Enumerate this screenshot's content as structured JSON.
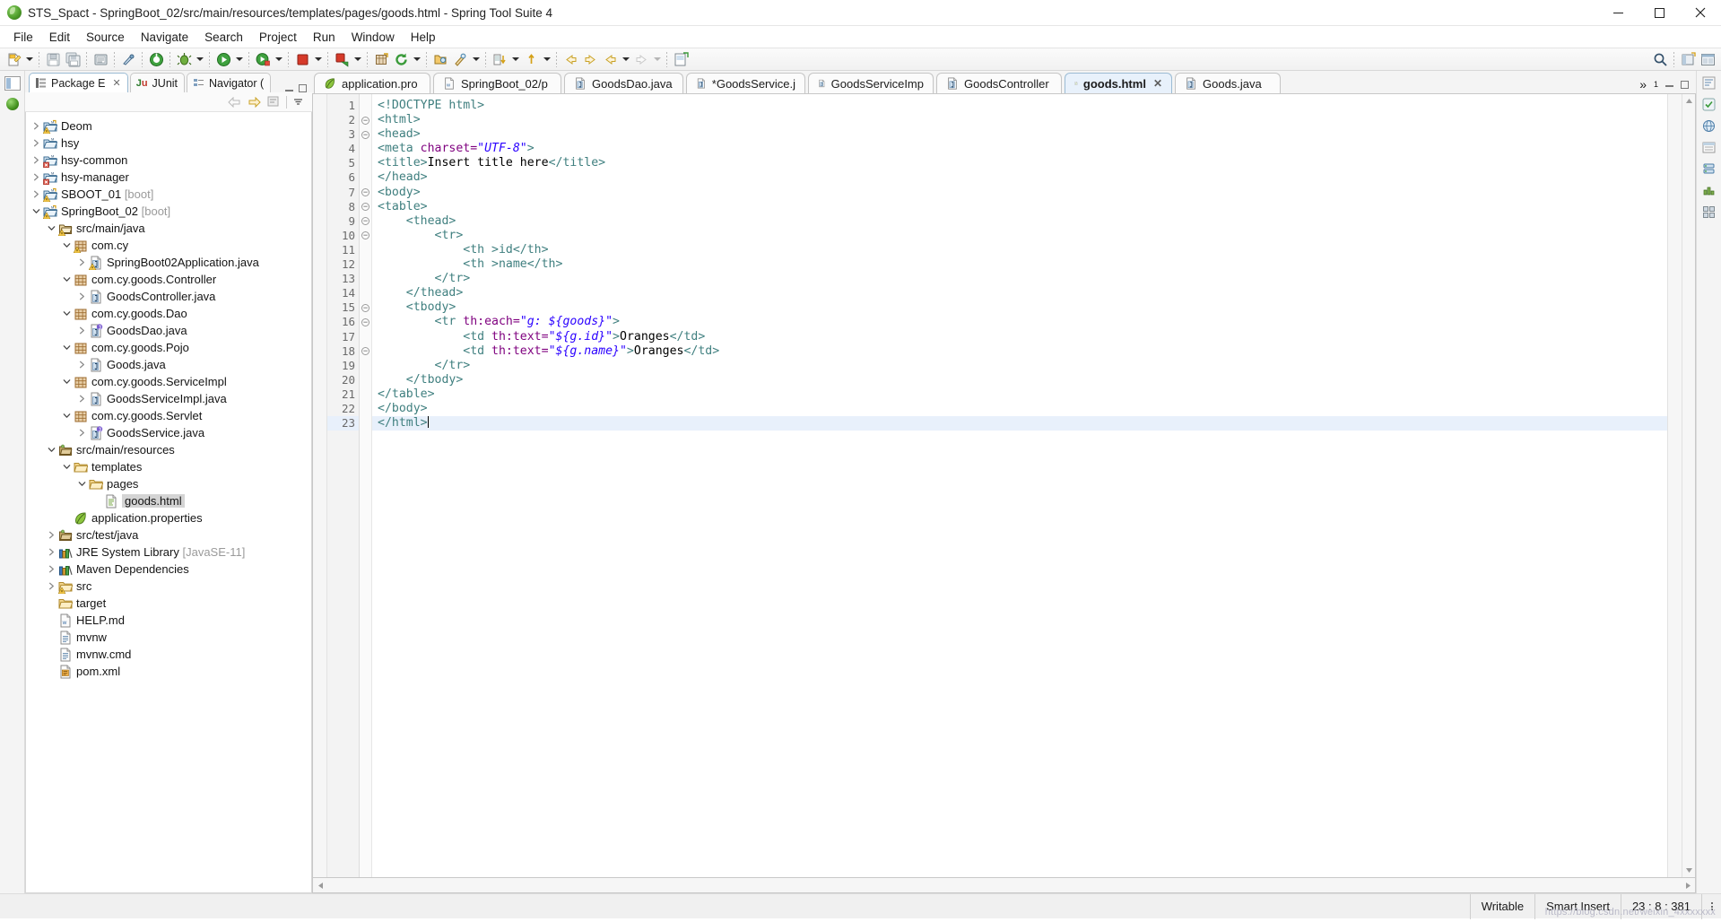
{
  "window": {
    "title": "STS_Spact - SpringBoot_02/src/main/resources/templates/pages/goods.html - Spring Tool Suite 4",
    "app_icon": "spring-leaf-icon",
    "controls": {
      "minimize": "minimize-button",
      "maximize": "maximize-button",
      "close": "close-button"
    }
  },
  "menubar": {
    "items": [
      "File",
      "Edit",
      "Source",
      "Navigate",
      "Search",
      "Project",
      "Run",
      "Window",
      "Help"
    ]
  },
  "toolbar": {
    "groups": [
      {
        "buttons": [
          {
            "icon": "new-wizard-icon",
            "dropdown": true
          }
        ]
      },
      {
        "buttons": [
          {
            "icon": "save-icon",
            "dropdown": false
          },
          {
            "icon": "save-all-icon",
            "dropdown": false
          }
        ]
      },
      {
        "buttons": [
          {
            "icon": "print-icon",
            "dropdown": false
          }
        ]
      },
      {
        "buttons": [
          {
            "icon": "quick-access-icon",
            "dropdown": false
          }
        ]
      },
      {
        "buttons": [
          {
            "icon": "boot-dashboard-icon",
            "dropdown": false
          }
        ]
      },
      {
        "buttons": [
          {
            "icon": "debug-icon",
            "dropdown": true
          }
        ]
      },
      {
        "buttons": [
          {
            "icon": "run-icon",
            "dropdown": true
          }
        ]
      },
      {
        "buttons": [
          {
            "icon": "run-coverage-icon",
            "dropdown": true
          }
        ]
      },
      {
        "buttons": [
          {
            "icon": "stop-icon",
            "dropdown": true
          }
        ]
      },
      {
        "buttons": [
          {
            "icon": "terminate-relaunch-icon",
            "dropdown": true
          }
        ]
      },
      {
        "buttons": [
          {
            "icon": "new-package-icon",
            "dropdown": false
          },
          {
            "icon": "refresh-icon",
            "dropdown": true
          }
        ]
      },
      {
        "buttons": [
          {
            "icon": "open-type-icon",
            "dropdown": false
          },
          {
            "icon": "search-icon",
            "dropdown": true
          }
        ]
      },
      {
        "buttons": [
          {
            "icon": "next-annotation-icon",
            "dropdown": true
          },
          {
            "icon": "previous-annotation-icon",
            "dropdown": true
          }
        ]
      },
      {
        "buttons": [
          {
            "icon": "back-icon",
            "dropdown": false
          },
          {
            "icon": "forward-icon",
            "dropdown": false
          },
          {
            "icon": "last-edit-icon",
            "dropdown": true
          },
          {
            "icon": "forward-nav-icon",
            "dropdown": true
          }
        ]
      },
      {
        "buttons": [
          {
            "icon": "new-editor-icon",
            "dropdown": false
          }
        ]
      }
    ],
    "right_buttons": [
      {
        "icon": "search-icon"
      },
      {
        "icon": "perspective-open-icon"
      },
      {
        "icon": "perspective-java-icon"
      }
    ]
  },
  "explorer": {
    "view_tabs": [
      {
        "label": "Package E",
        "icon": "package-explorer-icon",
        "active": true,
        "closable": true
      },
      {
        "label": "JUnit",
        "icon": "junit-icon",
        "active": false,
        "closable": false
      },
      {
        "label": "Navigator (",
        "icon": "navigator-icon",
        "active": false,
        "closable": false
      }
    ],
    "view_toolbar": [
      {
        "icon": "back-arrow-icon"
      },
      {
        "icon": "forward-arrow-icon"
      },
      {
        "icon": "collapse-all-icon"
      },
      {
        "icon": "link-with-editor-icon"
      },
      {
        "icon": "view-menu-icon"
      }
    ],
    "tree": [
      {
        "indent": 0,
        "twist": "collapsed",
        "icon": "java-project-warning-icon",
        "label": "Deom",
        "suffix": ""
      },
      {
        "indent": 0,
        "twist": "collapsed",
        "icon": "maven-project-icon",
        "label": "hsy",
        "suffix": ""
      },
      {
        "indent": 0,
        "twist": "collapsed",
        "icon": "maven-project-error-icon",
        "label": "hsy-common",
        "suffix": ""
      },
      {
        "indent": 0,
        "twist": "collapsed",
        "icon": "maven-project-error-icon",
        "label": "hsy-manager",
        "suffix": ""
      },
      {
        "indent": 0,
        "twist": "collapsed",
        "icon": "maven-java-project-warning-icon",
        "label": "SBOOT_01",
        "suffix": "[boot]"
      },
      {
        "indent": 0,
        "twist": "expanded",
        "icon": "maven-java-project-warning-icon",
        "label": "SpringBoot_02",
        "suffix": "[boot]"
      },
      {
        "indent": 1,
        "twist": "expanded",
        "icon": "source-folder-warning-icon",
        "label": "src/main/java",
        "suffix": ""
      },
      {
        "indent": 2,
        "twist": "expanded",
        "icon": "package-warning-icon",
        "label": "com.cy",
        "suffix": ""
      },
      {
        "indent": 3,
        "twist": "collapsed",
        "icon": "java-class-warning-icon",
        "label": "SpringBoot02Application.java",
        "suffix": ""
      },
      {
        "indent": 2,
        "twist": "expanded",
        "icon": "package-icon",
        "label": "com.cy.goods.Controller",
        "suffix": ""
      },
      {
        "indent": 3,
        "twist": "collapsed",
        "icon": "java-class-icon",
        "label": "GoodsController.java",
        "suffix": ""
      },
      {
        "indent": 2,
        "twist": "expanded",
        "icon": "package-icon",
        "label": "com.cy.goods.Dao",
        "suffix": ""
      },
      {
        "indent": 3,
        "twist": "collapsed",
        "icon": "java-interface-icon",
        "label": "GoodsDao.java",
        "suffix": ""
      },
      {
        "indent": 2,
        "twist": "expanded",
        "icon": "package-icon",
        "label": "com.cy.goods.Pojo",
        "suffix": ""
      },
      {
        "indent": 3,
        "twist": "collapsed",
        "icon": "java-class-icon",
        "label": "Goods.java",
        "suffix": ""
      },
      {
        "indent": 2,
        "twist": "expanded",
        "icon": "package-icon",
        "label": "com.cy.goods.ServiceImpl",
        "suffix": ""
      },
      {
        "indent": 3,
        "twist": "collapsed",
        "icon": "java-class-icon",
        "label": "GoodsServiceImpl.java",
        "suffix": ""
      },
      {
        "indent": 2,
        "twist": "expanded",
        "icon": "package-icon",
        "label": "com.cy.goods.Servlet",
        "suffix": ""
      },
      {
        "indent": 3,
        "twist": "collapsed",
        "icon": "java-interface-icon",
        "label": "GoodsService.java",
        "suffix": ""
      },
      {
        "indent": 1,
        "twist": "expanded",
        "icon": "source-folder-icon",
        "label": "src/main/resources",
        "suffix": ""
      },
      {
        "indent": 2,
        "twist": "expanded",
        "icon": "folder-icon",
        "label": "templates",
        "suffix": ""
      },
      {
        "indent": 3,
        "twist": "expanded",
        "icon": "folder-icon",
        "label": "pages",
        "suffix": ""
      },
      {
        "indent": 4,
        "twist": "none",
        "icon": "html-file-icon",
        "label": "goods.html",
        "suffix": "",
        "selected": true
      },
      {
        "indent": 2,
        "twist": "none",
        "icon": "properties-leaf-icon",
        "label": "application.properties",
        "suffix": ""
      },
      {
        "indent": 1,
        "twist": "collapsed",
        "icon": "source-folder-icon",
        "label": "src/test/java",
        "suffix": ""
      },
      {
        "indent": 1,
        "twist": "collapsed",
        "icon": "library-icon",
        "label": "JRE System Library",
        "suffix": "[JavaSE-11]"
      },
      {
        "indent": 1,
        "twist": "collapsed",
        "icon": "library-icon",
        "label": "Maven Dependencies",
        "suffix": ""
      },
      {
        "indent": 1,
        "twist": "collapsed",
        "icon": "folder-warning-icon",
        "label": "src",
        "suffix": ""
      },
      {
        "indent": 1,
        "twist": "none",
        "icon": "folder-icon",
        "label": "target",
        "suffix": ""
      },
      {
        "indent": 1,
        "twist": "none",
        "icon": "markdown-file-icon",
        "label": "HELP.md",
        "suffix": ""
      },
      {
        "indent": 1,
        "twist": "none",
        "icon": "text-file-icon",
        "label": "mvnw",
        "suffix": ""
      },
      {
        "indent": 1,
        "twist": "none",
        "icon": "text-file-icon",
        "label": "mvnw.cmd",
        "suffix": ""
      },
      {
        "indent": 1,
        "twist": "none",
        "icon": "xml-file-icon",
        "label": "pom.xml",
        "suffix": ""
      }
    ]
  },
  "editor": {
    "tabs": [
      {
        "label": "application.pro",
        "icon": "properties-leaf-icon",
        "active": false,
        "dirty": false,
        "closable": false
      },
      {
        "label": "SpringBoot_02/p",
        "icon": "markdown-file-icon",
        "active": false,
        "dirty": false,
        "closable": false
      },
      {
        "label": "GoodsDao.java",
        "icon": "java-file-icon",
        "active": false,
        "dirty": false,
        "closable": false
      },
      {
        "label": "*GoodsService.j",
        "icon": "java-file-icon",
        "active": false,
        "dirty": true,
        "closable": false
      },
      {
        "label": "GoodsServiceImp",
        "icon": "java-file-icon",
        "active": false,
        "dirty": false,
        "closable": false
      },
      {
        "label": "GoodsController",
        "icon": "java-file-icon",
        "active": false,
        "dirty": false,
        "closable": false
      },
      {
        "label": "goods.html",
        "icon": "html-file-icon",
        "active": true,
        "dirty": false,
        "closable": true
      },
      {
        "label": "Goods.java",
        "icon": "java-file-icon",
        "active": false,
        "dirty": false,
        "closable": false
      }
    ],
    "overflow_label": "»",
    "overflow_count": "1",
    "lines": [
      {
        "num": "1",
        "fold": "none",
        "indent": 0,
        "tokens": [
          {
            "t": "tag",
            "v": "<!DOCTYPE html>"
          }
        ]
      },
      {
        "num": "2",
        "fold": "collapse",
        "indent": 0,
        "tokens": [
          {
            "t": "tag",
            "v": "<html>"
          }
        ]
      },
      {
        "num": "3",
        "fold": "collapse",
        "indent": 0,
        "tokens": [
          {
            "t": "tag",
            "v": "<head>"
          }
        ]
      },
      {
        "num": "4",
        "fold": "none",
        "indent": 0,
        "tokens": [
          {
            "t": "tag",
            "v": "<meta "
          },
          {
            "t": "attr",
            "v": "charset="
          },
          {
            "t": "val",
            "v": "\"UTF-8\""
          },
          {
            "t": "tag",
            "v": ">"
          }
        ]
      },
      {
        "num": "5",
        "fold": "none",
        "indent": 0,
        "tokens": [
          {
            "t": "tag",
            "v": "<title>"
          },
          {
            "t": "txt",
            "v": "Insert title here"
          },
          {
            "t": "tag",
            "v": "</title>"
          }
        ]
      },
      {
        "num": "6",
        "fold": "none",
        "indent": 0,
        "tokens": [
          {
            "t": "tag",
            "v": "</head>"
          }
        ]
      },
      {
        "num": "7",
        "fold": "collapse",
        "indent": 0,
        "tokens": [
          {
            "t": "tag",
            "v": "<body>"
          }
        ]
      },
      {
        "num": "8",
        "fold": "collapse",
        "indent": 0,
        "tokens": [
          {
            "t": "tag",
            "v": "<table>"
          }
        ]
      },
      {
        "num": "9",
        "fold": "collapse",
        "indent": 1,
        "tokens": [
          {
            "t": "tag",
            "v": "<thead>"
          }
        ]
      },
      {
        "num": "10",
        "fold": "collapse",
        "indent": 2,
        "tokens": [
          {
            "t": "tag",
            "v": "<tr>"
          }
        ]
      },
      {
        "num": "11",
        "fold": "none",
        "indent": 3,
        "tokens": [
          {
            "t": "tag",
            "v": "<th >id</th>"
          }
        ]
      },
      {
        "num": "12",
        "fold": "none",
        "indent": 3,
        "tokens": [
          {
            "t": "tag",
            "v": "<th >name</th>"
          }
        ]
      },
      {
        "num": "13",
        "fold": "none",
        "indent": 2,
        "tokens": [
          {
            "t": "tag",
            "v": "</tr>"
          }
        ]
      },
      {
        "num": "14",
        "fold": "none",
        "indent": 1,
        "tokens": [
          {
            "t": "tag",
            "v": "</thead>"
          }
        ]
      },
      {
        "num": "15",
        "fold": "collapse",
        "indent": 1,
        "tokens": [
          {
            "t": "tag",
            "v": "<tbody>"
          }
        ]
      },
      {
        "num": "16",
        "fold": "collapse",
        "indent": 2,
        "tokens": [
          {
            "t": "tag",
            "v": "<tr "
          },
          {
            "t": "attr",
            "v": "th:each="
          },
          {
            "t": "val",
            "v": "\"g: ${goods}\""
          },
          {
            "t": "tag",
            "v": ">"
          }
        ]
      },
      {
        "num": "17",
        "fold": "none",
        "indent": 3,
        "tokens": [
          {
            "t": "tag",
            "v": "<td "
          },
          {
            "t": "attr",
            "v": "th:text="
          },
          {
            "t": "val",
            "v": "\"${g.id}\""
          },
          {
            "t": "tag",
            "v": ">"
          },
          {
            "t": "txt",
            "v": "Oranges"
          },
          {
            "t": "tag",
            "v": "</td>"
          }
        ]
      },
      {
        "num": "18",
        "fold": "collapse",
        "indent": 3,
        "tokens": [
          {
            "t": "tag",
            "v": "<td "
          },
          {
            "t": "attr",
            "v": "th:text="
          },
          {
            "t": "val",
            "v": "\"${g.name}\""
          },
          {
            "t": "tag",
            "v": ">"
          },
          {
            "t": "txt",
            "v": "Oranges"
          },
          {
            "t": "tag",
            "v": "</td>"
          }
        ]
      },
      {
        "num": "19",
        "fold": "none",
        "indent": 2,
        "tokens": [
          {
            "t": "tag",
            "v": "</tr>"
          }
        ]
      },
      {
        "num": "20",
        "fold": "none",
        "indent": 1,
        "tokens": [
          {
            "t": "tag",
            "v": "</tbody>"
          }
        ]
      },
      {
        "num": "21",
        "fold": "none",
        "indent": 0,
        "tokens": [
          {
            "t": "tag",
            "v": "</table>"
          }
        ]
      },
      {
        "num": "22",
        "fold": "none",
        "indent": 0,
        "tokens": [
          {
            "t": "tag",
            "v": "</body>"
          }
        ]
      },
      {
        "num": "23",
        "fold": "none",
        "indent": 0,
        "current": true,
        "tokens": [
          {
            "t": "tag",
            "v": "</html>"
          }
        ]
      }
    ]
  },
  "statusbar": {
    "writable": "Writable",
    "insert_mode": "Smart Insert",
    "position": "23 : 8 : 381"
  },
  "watermark": "https://blog.csdn.net/weixin_4xxxxxxx",
  "colors": {
    "accent": "#e8f1fb",
    "tab_border": "#9bbbd4",
    "tag": "#3f7f7f",
    "attr": "#7f007f",
    "value": "#2a00ff",
    "gutter_text": "#6b6b6b",
    "selection": "#d4d4d4"
  }
}
